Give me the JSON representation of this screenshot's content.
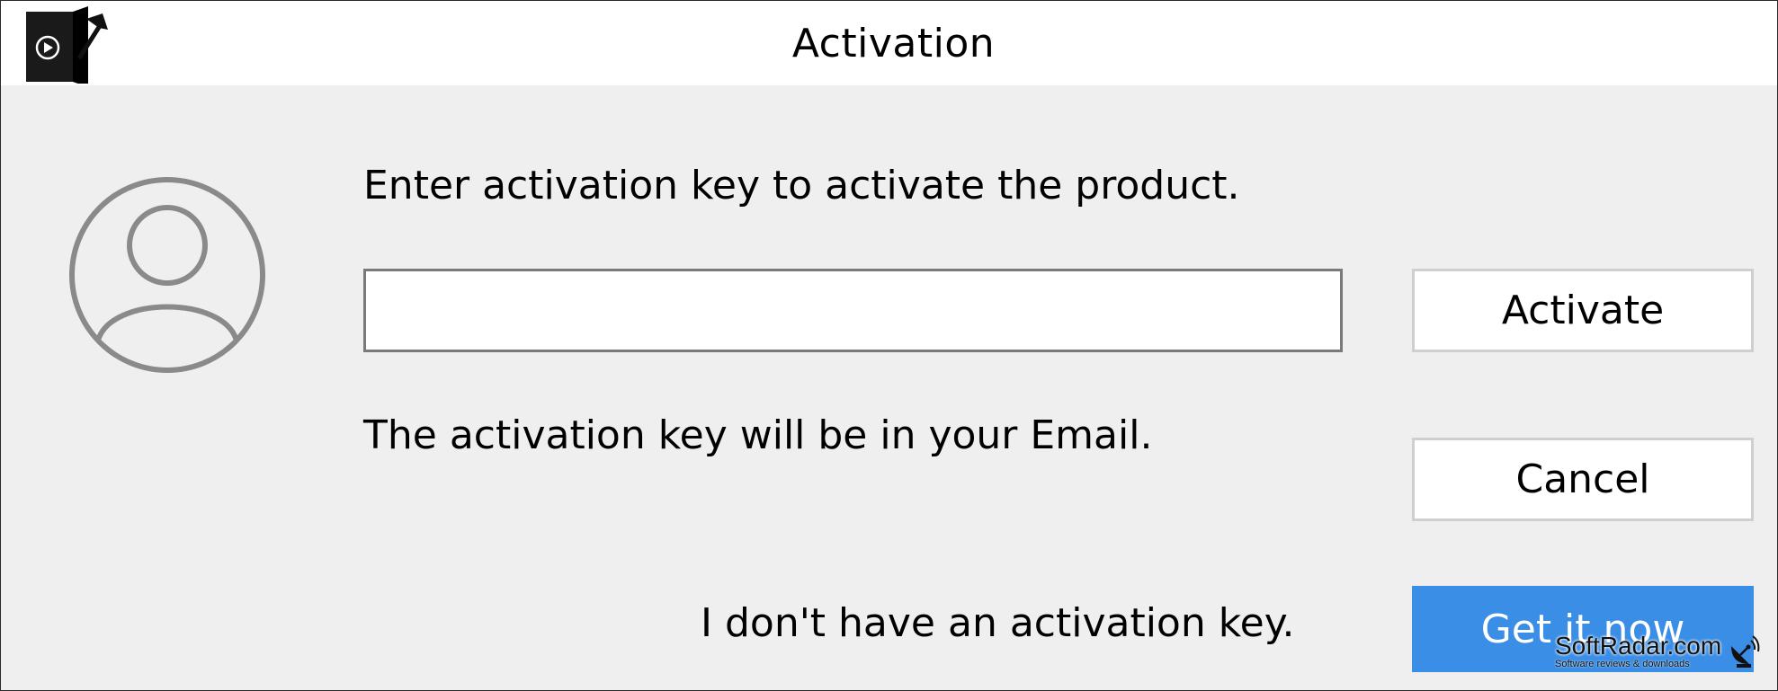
{
  "window": {
    "title": "Activation",
    "app_icon": "video-app-hammer-icon"
  },
  "dialog": {
    "avatar_icon": "user-circle-icon",
    "prompt": "Enter activation key to activate the product.",
    "key_input": {
      "value": "",
      "placeholder": ""
    },
    "hint": "The activation key will be in your Email.",
    "no_key_link": "I don't have an activation key.",
    "buttons": {
      "activate": "Activate",
      "cancel": "Cancel",
      "get_it_now": "Get it now"
    }
  },
  "watermark": {
    "name": "SoftRadar.com",
    "tagline": "Software reviews & downloads",
    "icon": "radar-dish-icon"
  },
  "colors": {
    "dialog_background": "#efefef",
    "primary_button": "#3a8ee6"
  }
}
